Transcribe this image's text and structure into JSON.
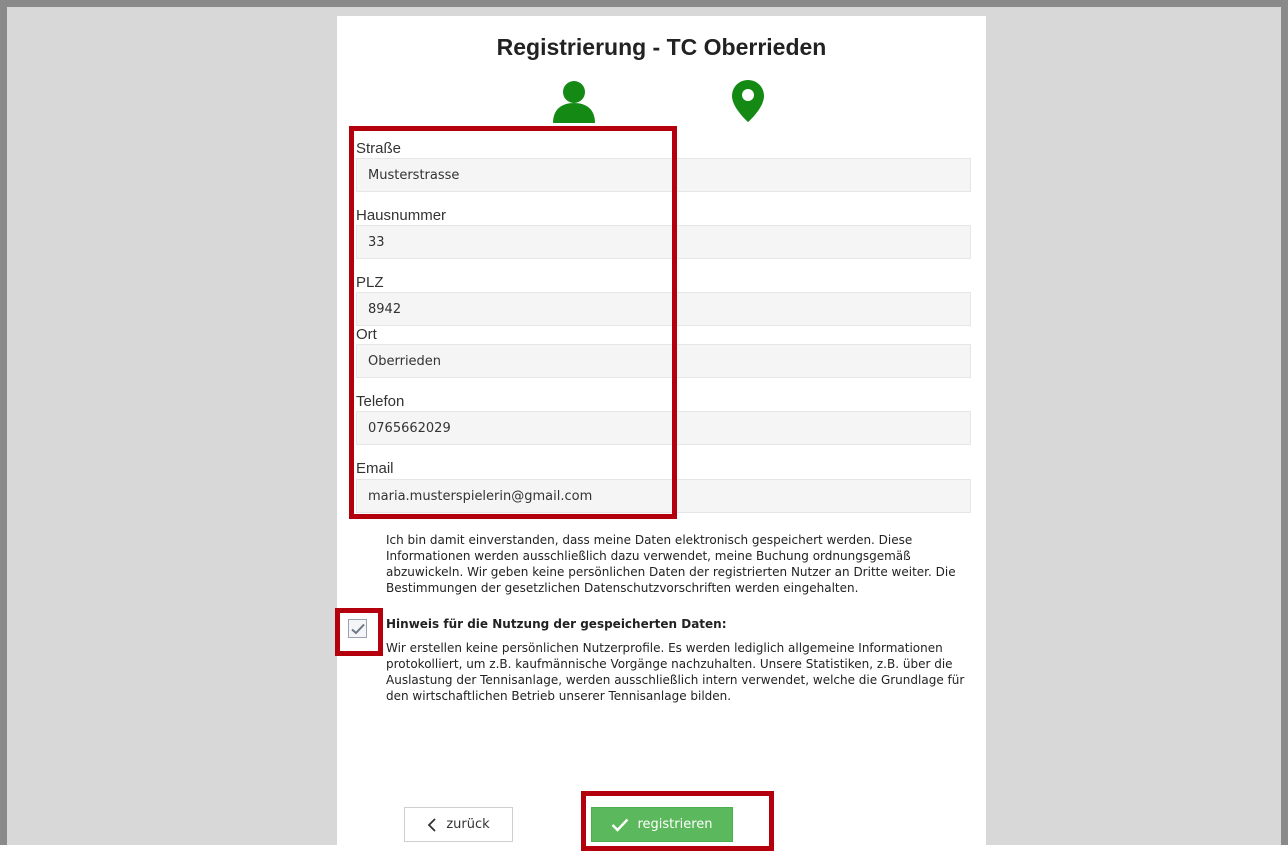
{
  "header": {
    "title": "Registrierung - TC Oberrieden"
  },
  "steps": [
    {
      "icon": "user-icon",
      "color": "#148a14"
    },
    {
      "icon": "map-marker-icon",
      "color": "#148a14"
    }
  ],
  "form": {
    "fields": [
      {
        "label": "Straße",
        "value": "Musterstrasse"
      },
      {
        "label": "Hausnummer",
        "value": "33"
      },
      {
        "label": "PLZ",
        "value": "8942"
      },
      {
        "label": "Ort",
        "value": "Oberrieden"
      },
      {
        "label": "Telefon",
        "value": "0765662029"
      },
      {
        "label": "Email",
        "value": "maria.musterspielerin@gmail.com"
      }
    ]
  },
  "consent": {
    "text": "Ich bin damit einverstanden, dass meine Daten elektronisch gespeichert werden. Diese Informationen werden ausschließlich dazu verwendet, meine Buchung ordnungsgemäß abzuwickeln. Wir geben keine persönlichen Daten der registrierten Nutzer an Dritte weiter. Die Bestimmungen der gesetzlichen Datenschutzvorschriften werden eingehalten.",
    "note_title": "Hinweis für die Nutzung der gespeicherten Daten:",
    "note_text": "Wir erstellen keine persönlichen Nutzerprofile. Es werden lediglich allgemeine Informationen protokolliert, um z.B. kaufmännische Vorgänge nachzuhalten. Unsere Statistiken, z.B. über die Auslastung der Tennisanlage, werden ausschließlich intern verwendet, welche die Grundlage für den wirtschaftlichen Betrieb unserer Tennisanlage bilden.",
    "checked": true
  },
  "buttons": {
    "back_label": "zurück",
    "register_label": "registrieren"
  },
  "colors": {
    "accent_green": "#5cb85c",
    "icon_green": "#148a14",
    "highlight_red": "#b3000c"
  }
}
